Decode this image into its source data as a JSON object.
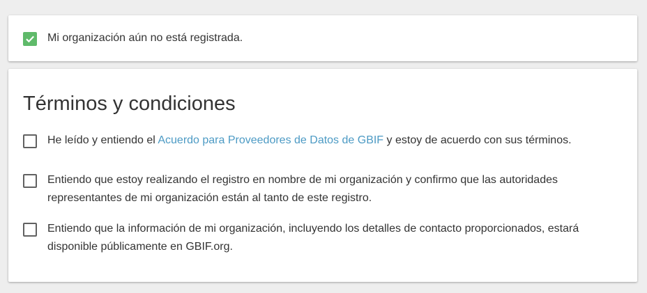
{
  "status": {
    "checked": true,
    "label": "Mi organización aún no está registrada."
  },
  "terms": {
    "title": "Términos y condiciones",
    "items": [
      {
        "checked": false,
        "text_before": "He leído y entiendo el ",
        "link_text": "Acuerdo para Proveedores de Datos de GBIF",
        "text_after": " y estoy de acuerdo con sus términos."
      },
      {
        "checked": false,
        "text": "Entiendo que estoy realizando el registro en nombre de mi organización y confirmo que las autoridades representantes de mi organización están al tanto de este registro."
      },
      {
        "checked": false,
        "text": "Entiendo que la información de mi organización, incluyendo los detalles de contacto proporcionados, estará disponible públicamente en GBIF.org."
      }
    ]
  },
  "colors": {
    "checkbox_checked": "#5fba6a",
    "link": "#4c9ac4",
    "text": "#333333"
  }
}
